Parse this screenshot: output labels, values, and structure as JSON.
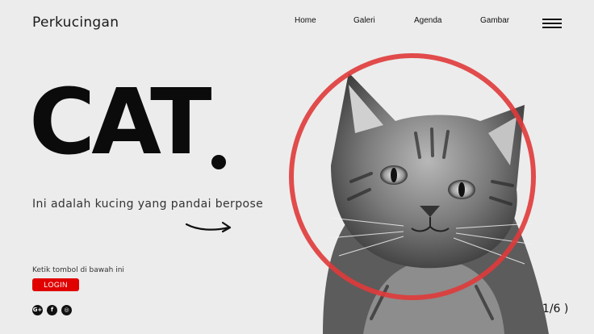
{
  "brand": {
    "name": "Perkucingan"
  },
  "nav": {
    "items": [
      {
        "label": "Home"
      },
      {
        "label": "Galeri"
      },
      {
        "label": "Agenda"
      },
      {
        "label": "Gambar"
      }
    ]
  },
  "hero": {
    "title": "CAT",
    "tagline": "Ini adalah kucing yang pandai berpose"
  },
  "cta": {
    "hint": "Ketik tombol di bawah ini",
    "login_label": "LOGIN"
  },
  "social": [
    {
      "icon": "google-plus-icon",
      "glyph": "G+"
    },
    {
      "icon": "facebook-icon",
      "glyph": "f"
    },
    {
      "icon": "instagram-icon",
      "glyph": "◎"
    }
  ],
  "pager": {
    "text": "( 1/6 )"
  },
  "colors": {
    "background": "#ececec",
    "accent_red": "#e00000",
    "circle_red": "#e03a3a",
    "text_dark": "#111111"
  }
}
